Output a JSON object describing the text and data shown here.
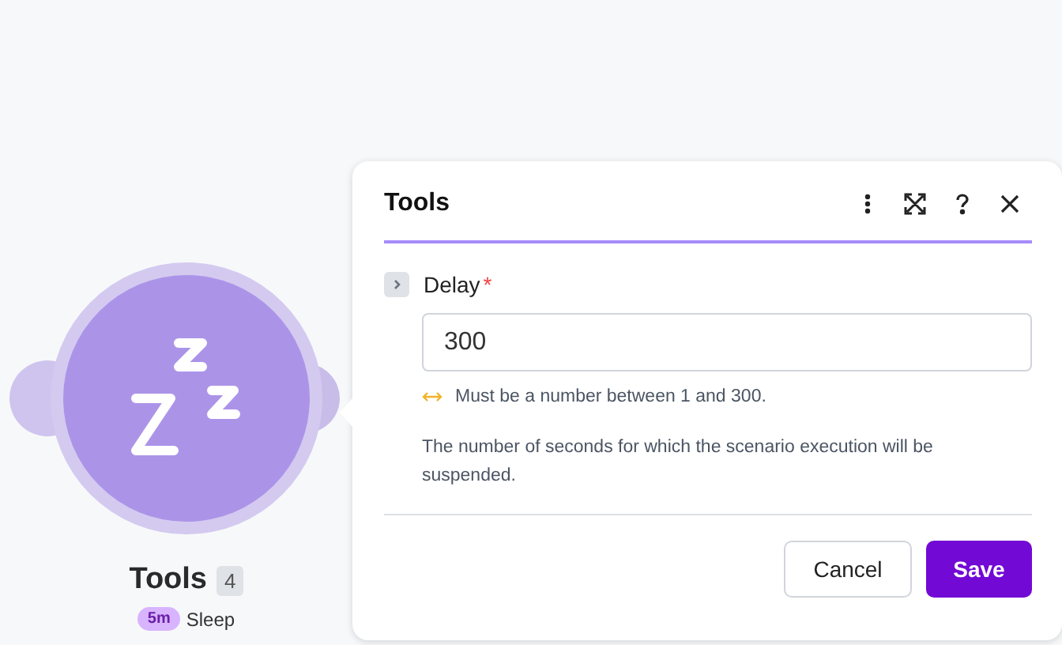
{
  "node": {
    "name": "Tools",
    "count": "4",
    "badge": "5m",
    "operation": "Sleep"
  },
  "panel": {
    "title": "Tools",
    "actions": [
      {
        "kind": "more"
      },
      {
        "kind": "expand"
      },
      {
        "kind": "help"
      },
      {
        "kind": "close"
      }
    ],
    "field": {
      "label": "Delay",
      "required": true,
      "required_mark": "*",
      "expanded": false,
      "value": "300",
      "hint": "Must be a number between 1 and 300.",
      "description": "The number of seconds for which the scenario execution will be suspended."
    },
    "buttons": [
      {
        "label": "Cancel",
        "kind": "secondary"
      },
      {
        "label": "Save",
        "kind": "primary"
      }
    ]
  }
}
